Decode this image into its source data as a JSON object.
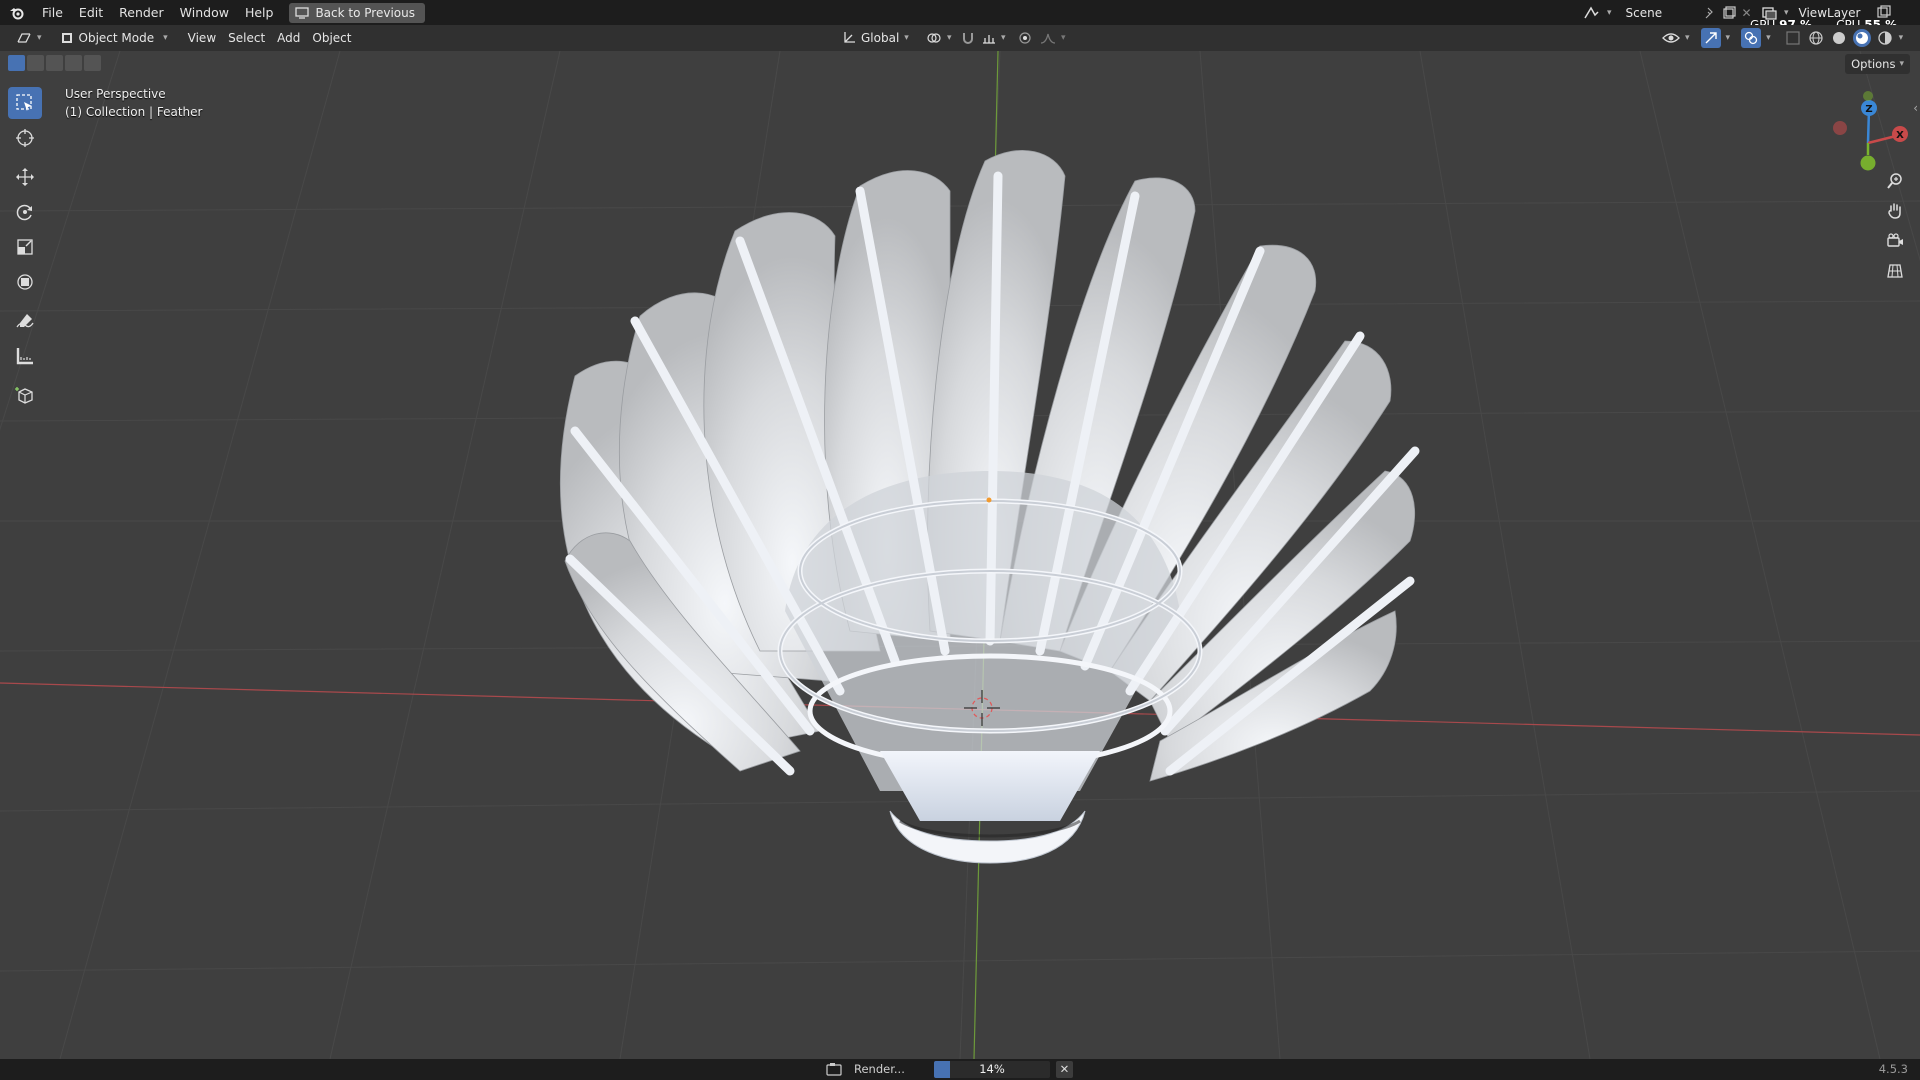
{
  "menu": {
    "items": [
      "File",
      "Edit",
      "Render",
      "Window",
      "Help"
    ],
    "back_button": "Back to Previous"
  },
  "topbar_right": {
    "scene_label": "Scene",
    "viewlayer_label": "ViewLayer",
    "gpu_label": "GPU",
    "gpu_value": "97 %",
    "cpu_label": "CPU",
    "cpu_value": "55 %"
  },
  "header": {
    "mode": "Object Mode",
    "menus": [
      "View",
      "Select",
      "Add",
      "Object"
    ],
    "orientation": "Global"
  },
  "viewport": {
    "view_name": "User Perspective",
    "collection_info": "(1) Collection | Feather",
    "options_label": "Options"
  },
  "gizmo": {
    "z": "Z",
    "x": "X"
  },
  "status": {
    "render_label": "Render...",
    "progress_text": "14%",
    "progress": 0.14,
    "version": "4.5.3"
  },
  "colors": {
    "accent": "#4772b3",
    "x_axis": "#c84a4a",
    "y_axis": "#7ab42e",
    "z_axis": "#3a87d6"
  }
}
